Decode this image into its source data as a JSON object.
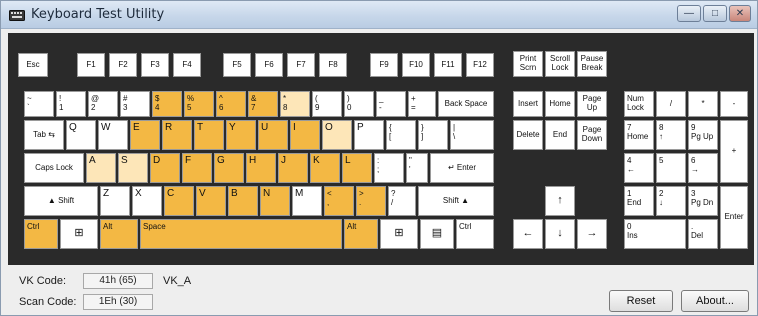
{
  "window": {
    "title": "Keyboard Test Utility"
  },
  "titlebar": {
    "min_glyph": "—",
    "max_glyph": "□",
    "close_glyph": "✕"
  },
  "keys": {
    "esc": "Esc",
    "f1": "F1",
    "f2": "F2",
    "f3": "F3",
    "f4": "F4",
    "f5": "F5",
    "f6": "F6",
    "f7": "F7",
    "f8": "F8",
    "f9": "F9",
    "f10": "F10",
    "f11": "F11",
    "f12": "F12",
    "prtsc_1": "Print",
    "prtsc_2": "Scrn",
    "scroll_1": "Scroll",
    "scroll_2": "Lock",
    "pause_1": "Pause",
    "pause_2": "Break",
    "grave_1": "~",
    "grave_2": "`",
    "n1_1": "!",
    "n1_2": "1",
    "n2_1": "@",
    "n2_2": "2",
    "n3_1": "#",
    "n3_2": "3",
    "n4_1": "$",
    "n4_2": "4",
    "n5_1": "%",
    "n5_2": "5",
    "n6_1": "^",
    "n6_2": "6",
    "n7_1": "&",
    "n7_2": "7",
    "n8_1": "*",
    "n8_2": "8",
    "n9_1": "(",
    "n9_2": "9",
    "n0_1": ")",
    "n0_2": "0",
    "minus_1": "_",
    "minus_2": "-",
    "eq_1": "+",
    "eq_2": "=",
    "backspace": "Back Space",
    "insert": "Insert",
    "home": "Home",
    "pgup_1": "Page",
    "pgup_2": "Up",
    "numlock_1": "Num",
    "numlock_2": "Lock",
    "num_div": "/",
    "num_mul": "*",
    "num_sub": "-",
    "tab": "Tab ⇆",
    "q": "Q",
    "w": "W",
    "e": "E",
    "r": "R",
    "t": "T",
    "y": "Y",
    "u": "U",
    "i": "I",
    "o": "O",
    "p": "P",
    "lbr_1": "{",
    "lbr_2": "[",
    "rbr_1": "}",
    "rbr_2": "]",
    "bsl_1": "|",
    "bsl_2": "\\",
    "delete": "Delete",
    "end": "End",
    "pgdn_1": "Page",
    "pgdn_2": "Down",
    "num7_1": "7",
    "num7_2": "Home",
    "num8_1": "8",
    "num8_2": "↑",
    "num9_1": "9",
    "num9_2": "Pg Up",
    "num_add": "+",
    "capslock": "Caps Lock",
    "a": "A",
    "s": "S",
    "d": "D",
    "f": "F",
    "g": "G",
    "h": "H",
    "j": "J",
    "k": "K",
    "l": "L",
    "semi_1": ":",
    "semi_2": ";",
    "quote_1": "\"",
    "quote_2": "'",
    "enter": "↵ Enter",
    "num4_1": "4",
    "num4_2": "←",
    "num5": "5",
    "num6_1": "6",
    "num6_2": "→",
    "lshift": "▲   Shift",
    "z": "Z",
    "x": "X",
    "c": "C",
    "v": "V",
    "b": "B",
    "n": "N",
    "m": "M",
    "comma_1": "<",
    "comma_2": ",",
    "period_1": ">",
    "period_2": ".",
    "slash_1": "?",
    "slash_2": "/",
    "rshift": "Shift   ▲",
    "up": "↑",
    "num1_1": "1",
    "num1_2": "End",
    "num2_1": "2",
    "num2_2": "↓",
    "num3_1": "3",
    "num3_2": "Pg Dn",
    "num_enter": "Enter",
    "lctrl": "Ctrl",
    "lwin": "⊞",
    "lalt": "Alt",
    "space": "Space",
    "ralt": "Alt",
    "rwin": "⊞",
    "menu": "▤",
    "rctrl": "Ctrl",
    "left": "←",
    "down": "↓",
    "right": "→",
    "num0_1": "0",
    "num0_2": "Ins",
    "numdot_1": ".",
    "numdot_2": "Del"
  },
  "status": {
    "vk_label": "VK Code:",
    "vk_value": "41h (65)",
    "vk_name": "VK_A",
    "scan_label": "Scan Code:",
    "scan_value": "1Eh (30)"
  },
  "buttons": {
    "reset": "Reset",
    "about": "About..."
  },
  "colors": {
    "pressed": "#f3b844",
    "recent": "#fde6b8",
    "idle": "#ffffff",
    "board": "#2a2a2a"
  }
}
